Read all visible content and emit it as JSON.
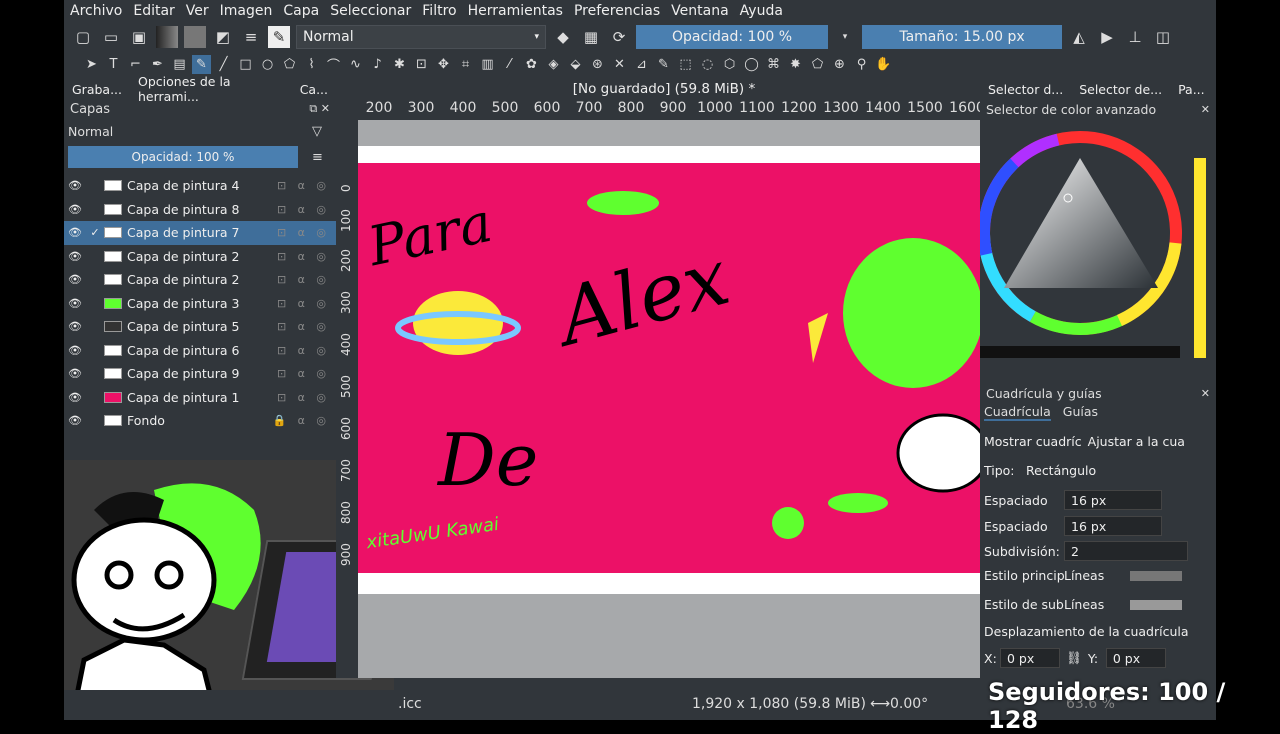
{
  "menu": [
    "Archivo",
    "Editar",
    "Ver",
    "Imagen",
    "Capa",
    "Seleccionar",
    "Filtro",
    "Herramientas",
    "Preferencias",
    "Ventana",
    "Ayuda"
  ],
  "toolbar": {
    "blend_mode": "Normal",
    "opacity": "Opacidad: 100 %",
    "size": "Tamaño: 15.00 px"
  },
  "left_tabs": [
    "Graba...",
    "Opciones de la herrami...",
    "Ca..."
  ],
  "layers_panel": {
    "title": "Capas",
    "blend_mode": "Normal",
    "opacity": "Opacidad: 100 %",
    "layers": [
      {
        "name": "Capa de pintura 4",
        "selected": false
      },
      {
        "name": "Capa de pintura 8",
        "selected": false
      },
      {
        "name": "Capa de pintura 7",
        "selected": true
      },
      {
        "name": "Capa de pintura 2",
        "selected": false
      },
      {
        "name": "Capa de pintura 2",
        "selected": false
      },
      {
        "name": "Capa de pintura 3",
        "selected": false
      },
      {
        "name": "Capa de pintura 5",
        "selected": false
      },
      {
        "name": "Capa de pintura 6",
        "selected": false
      },
      {
        "name": "Capa de pintura 9",
        "selected": false
      },
      {
        "name": "Capa de pintura 1",
        "selected": false
      },
      {
        "name": "Fondo",
        "selected": false
      }
    ]
  },
  "document": {
    "title": "[No guardado]  (59.8 MiB) *",
    "ruler_top": [
      "200",
      "300",
      "400",
      "500",
      "600",
      "700",
      "800",
      "900",
      "1000",
      "1100",
      "1200",
      "1300",
      "1400",
      "1500",
      "1600"
    ],
    "ruler_left": [
      "0",
      "100",
      "200",
      "300",
      "400",
      "500",
      "600",
      "700",
      "800",
      "900"
    ]
  },
  "canvas_text": {
    "para": "Para",
    "alex": "Alex",
    "de": "De",
    "signature": "xitaUwU Kawai"
  },
  "right_tabs": [
    "Selector d...",
    "Selector de...",
    "Pa..."
  ],
  "color_selector": {
    "title": "Selector de color avanzado"
  },
  "grid_panel": {
    "title": "Cuadrícula y guías",
    "tabs": [
      "Cuadrícula",
      "Guías"
    ],
    "show_grid": "Mostrar cuadríc",
    "snap_grid": "Ajustar a la cua",
    "type_label": "Tipo:",
    "type_value": "Rectángulo",
    "spacing_label": "Espaciado",
    "spacing_x": "16 px",
    "spacing_y": "16 px",
    "subdivision_label": "Subdivisión:",
    "subdivision_value": "2",
    "main_style_label": "Estilo principa",
    "main_style_value": "Líneas",
    "sub_style_label": "Estilo de subc",
    "sub_style_value": "Líneas",
    "offset_label": "Desplazamiento de la cuadrícula",
    "x_label": "X:",
    "x_value": "0 px",
    "y_label": "Y:",
    "y_value": "0 px"
  },
  "status": {
    "profile": ".icc",
    "dimensions": "1,920 x 1,080 (59.8 MiB)",
    "rotation": "0.00°",
    "zoom": "63.6 %"
  },
  "overlay": {
    "followers": "Seguidores: 100 / 128"
  },
  "colors": {
    "canvas_pink": "#ec1167",
    "selection": "#3f6e9a",
    "panel": "#31363b",
    "accent_green": "#5fff2f"
  }
}
